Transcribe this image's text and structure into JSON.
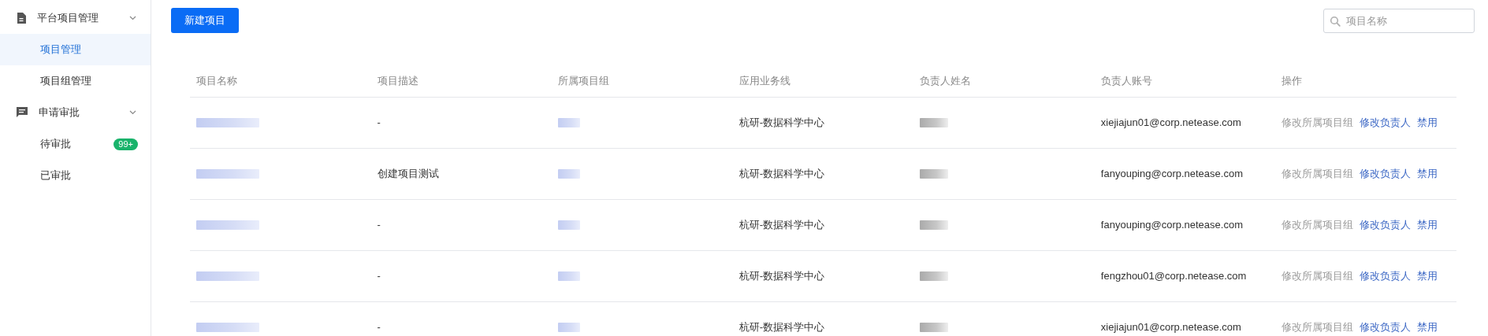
{
  "sidebar": {
    "groups": [
      {
        "label": "平台项目管理",
        "expanded": true,
        "items": [
          {
            "label": "项目管理",
            "selected": true
          },
          {
            "label": "项目组管理",
            "selected": false
          }
        ]
      },
      {
        "label": "申请审批",
        "expanded": true,
        "items": [
          {
            "label": "待审批",
            "selected": false,
            "badge": "99+"
          },
          {
            "label": "已审批",
            "selected": false
          }
        ]
      }
    ]
  },
  "toolbar": {
    "new_button": "新建项目",
    "search": {
      "placeholder": "项目名称"
    }
  },
  "table": {
    "columns": [
      "项目名称",
      "项目描述",
      "所属项目组",
      "应用业务线",
      "负责人姓名",
      "负责人账号",
      "操作"
    ],
    "rows": [
      {
        "description": "-",
        "business_line": "杭研-数据科学中心",
        "owner_account": "xiejiajun01@corp.netease.com",
        "actions": [
          {
            "label": "修改所属项目组",
            "disabled": true
          },
          {
            "label": "修改负责人",
            "disabled": false
          },
          {
            "label": "禁用",
            "disabled": false
          }
        ]
      },
      {
        "description": "创建项目测试",
        "business_line": "杭研-数据科学中心",
        "owner_account": "fanyouping@corp.netease.com",
        "actions": [
          {
            "label": "修改所属项目组",
            "disabled": true
          },
          {
            "label": "修改负责人",
            "disabled": false
          },
          {
            "label": "禁用",
            "disabled": false
          }
        ]
      },
      {
        "description": "-",
        "business_line": "杭研-数据科学中心",
        "owner_account": "fanyouping@corp.netease.com",
        "actions": [
          {
            "label": "修改所属项目组",
            "disabled": true
          },
          {
            "label": "修改负责人",
            "disabled": false
          },
          {
            "label": "禁用",
            "disabled": false
          }
        ]
      },
      {
        "description": "-",
        "business_line": "杭研-数据科学中心",
        "owner_account": "fengzhou01@corp.netease.com",
        "actions": [
          {
            "label": "修改所属项目组",
            "disabled": true
          },
          {
            "label": "修改负责人",
            "disabled": false
          },
          {
            "label": "禁用",
            "disabled": false
          }
        ]
      },
      {
        "description": "-",
        "business_line": "杭研-数据科学中心",
        "owner_account": "xiejiajun01@corp.netease.com",
        "actions": [
          {
            "label": "修改所属项目组",
            "disabled": true
          },
          {
            "label": "修改负责人",
            "disabled": false
          },
          {
            "label": "禁用",
            "disabled": false
          }
        ]
      }
    ]
  }
}
